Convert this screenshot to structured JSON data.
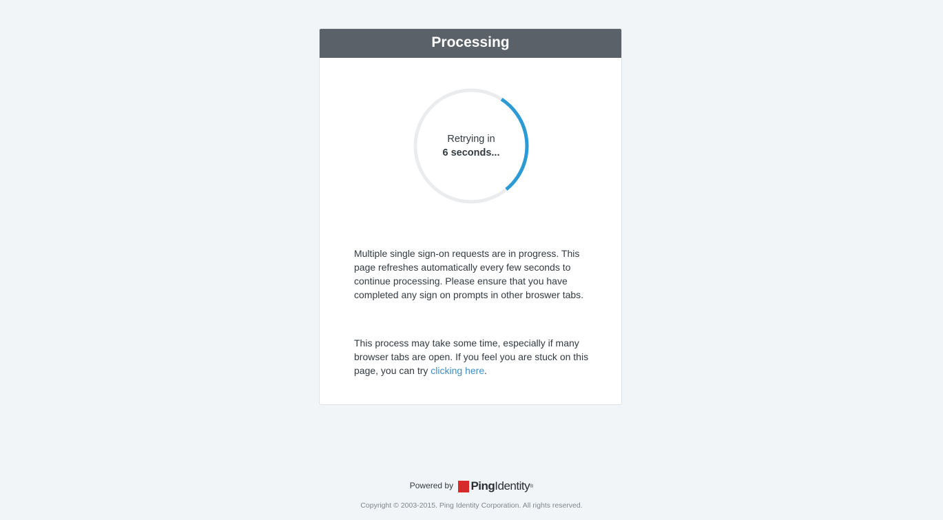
{
  "header": {
    "title": "Processing"
  },
  "spinner": {
    "line1": "Retrying in",
    "line2": "6 seconds...",
    "progress": 0.3,
    "track_color": "#ebeced",
    "progress_color": "#2e9ad4"
  },
  "message": {
    "paragraph1": "Multiple single sign-on requests are in progress. This page refreshes automatically every few seconds to continue processing. Please ensure that you have completed any sign on prompts in other broswer tabs.",
    "paragraph2_prefix": "This process may take some time, especially if many browser tabs are open. If you feel you are stuck on this page, you can try ",
    "link_text": "clicking here",
    "paragraph2_suffix": "."
  },
  "footer": {
    "powered_by": "Powered by",
    "brand_bold": "Ping",
    "brand_light": "Identity",
    "brand_mark": "®",
    "copyright": "Copyright © 2003-2015. Ping Identity Corporation. All rights reserved."
  }
}
